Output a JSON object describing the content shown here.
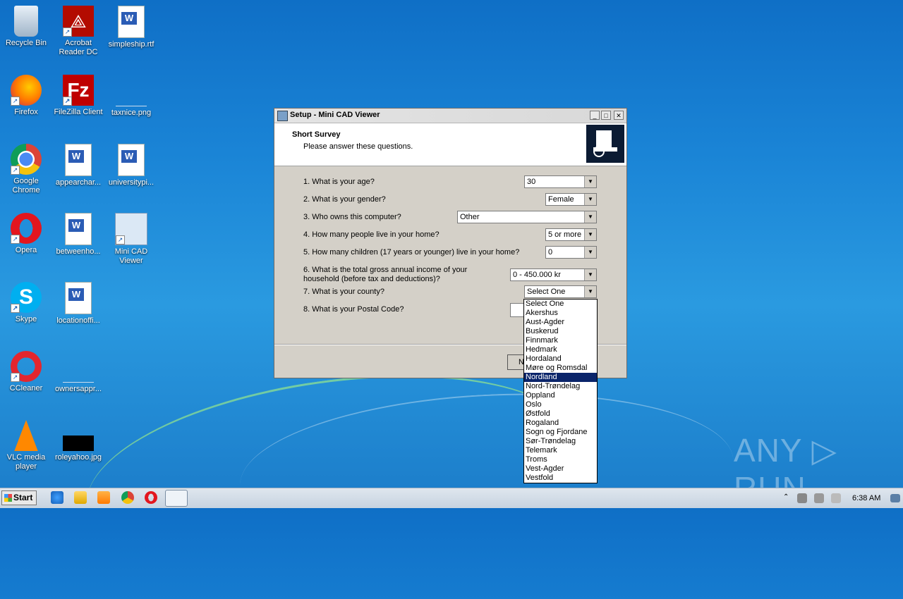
{
  "desktop": {
    "icons": [
      {
        "label": "Recycle Bin"
      },
      {
        "label": "Acrobat Reader DC"
      },
      {
        "label": "simpleship.rtf"
      },
      {
        "label": "Firefox"
      },
      {
        "label": "FileZilla Client"
      },
      {
        "label": "taxnice.png"
      },
      {
        "label": "Google Chrome"
      },
      {
        "label": "appearchar..."
      },
      {
        "label": "universitypi..."
      },
      {
        "label": "Opera"
      },
      {
        "label": "betweenho..."
      },
      {
        "label": "Mini CAD Viewer"
      },
      {
        "label": "Skype"
      },
      {
        "label": "locationoffi..."
      },
      {
        "label": "CCleaner"
      },
      {
        "label": "ownersappr..."
      },
      {
        "label": "VLC media player"
      },
      {
        "label": "roleyahoo.jpg"
      }
    ]
  },
  "dialog": {
    "title": "Setup - Mini CAD Viewer",
    "header_title": "Short Survey",
    "header_subtitle": "Please answer these questions.",
    "questions": [
      {
        "label": "1. What is your age?",
        "value": "30"
      },
      {
        "label": "2. What is your gender?",
        "value": "Female"
      },
      {
        "label": "3. Who owns this computer?",
        "value": "Other"
      },
      {
        "label": "4. How many people live in your home?",
        "value": "5 or more"
      },
      {
        "label": "5. How many children (17 years or younger) live in your home?",
        "value": "0"
      },
      {
        "label": "6. What is the total gross annual income of your",
        "label2": "household (before tax and deductions)?",
        "value": "0 - 450.000 kr"
      },
      {
        "label": "7. What is your county?",
        "value": "Select One"
      },
      {
        "label": "8. What is your Postal Code?",
        "value": ""
      }
    ],
    "next_button_partial": "N",
    "county_options": [
      "Select One",
      "Akershus",
      "Aust-Agder",
      "Buskerud",
      "Finnmark",
      "Hedmark",
      "Hordaland",
      "Møre og Romsdal",
      "Nordland",
      "Nord-Trøndelag",
      "Oppland",
      "Oslo",
      "Østfold",
      "Rogaland",
      "Sogn og Fjordane",
      "Sør-Trøndelag",
      "Telemark",
      "Troms",
      "Vest-Agder",
      "Vestfold"
    ],
    "county_selected_index": 8
  },
  "taskbar": {
    "start_label": "Start",
    "clock": "6:38 AM"
  },
  "watermark": "ANY ▷ RUN"
}
